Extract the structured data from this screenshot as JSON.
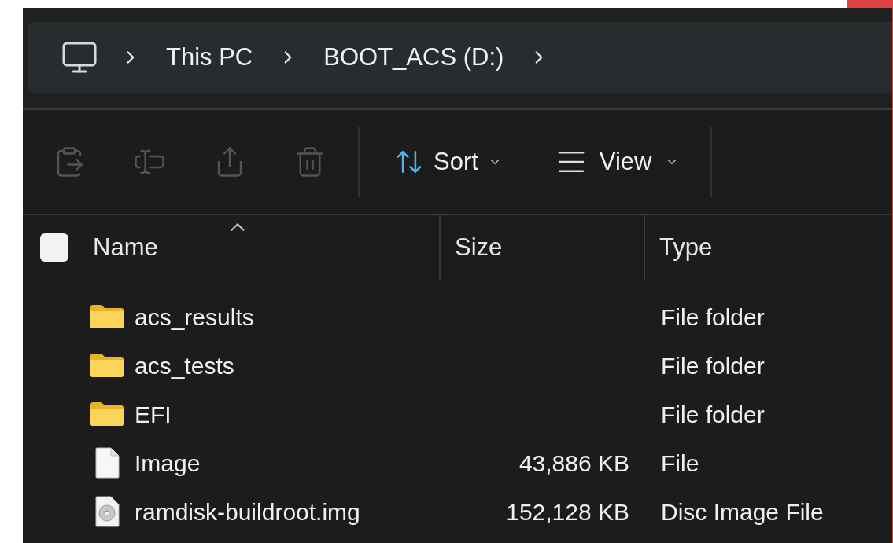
{
  "breadcrumb": [
    {
      "label": "This PC"
    },
    {
      "label": "BOOT_ACS (D:)"
    }
  ],
  "toolbar": {
    "actions": [
      {
        "kind": "paste",
        "disabled": true
      },
      {
        "kind": "rename",
        "disabled": true
      },
      {
        "kind": "share",
        "disabled": true
      },
      {
        "kind": "delete",
        "disabled": true
      }
    ],
    "sort": {
      "label": "Sort"
    },
    "view": {
      "label": "View"
    }
  },
  "columns": [
    {
      "label": "Name",
      "sorted": true
    },
    {
      "label": "Size",
      "sorted": false
    },
    {
      "label": "Type",
      "sorted": false
    }
  ],
  "select_all": {
    "checked": false
  },
  "rows": [
    {
      "kind": "folder",
      "name": "acs_results",
      "size": "",
      "type": "File folder"
    },
    {
      "kind": "folder",
      "name": "acs_tests",
      "size": "",
      "type": "File folder"
    },
    {
      "kind": "folder",
      "name": "EFI",
      "size": "",
      "type": "File folder"
    },
    {
      "kind": "file",
      "name": "Image",
      "size": "43,886 KB",
      "type": "File"
    },
    {
      "kind": "disc",
      "name": "ramdisk-buildroot.img",
      "size": "152,128 KB",
      "type": "Disc Image File"
    }
  ]
}
